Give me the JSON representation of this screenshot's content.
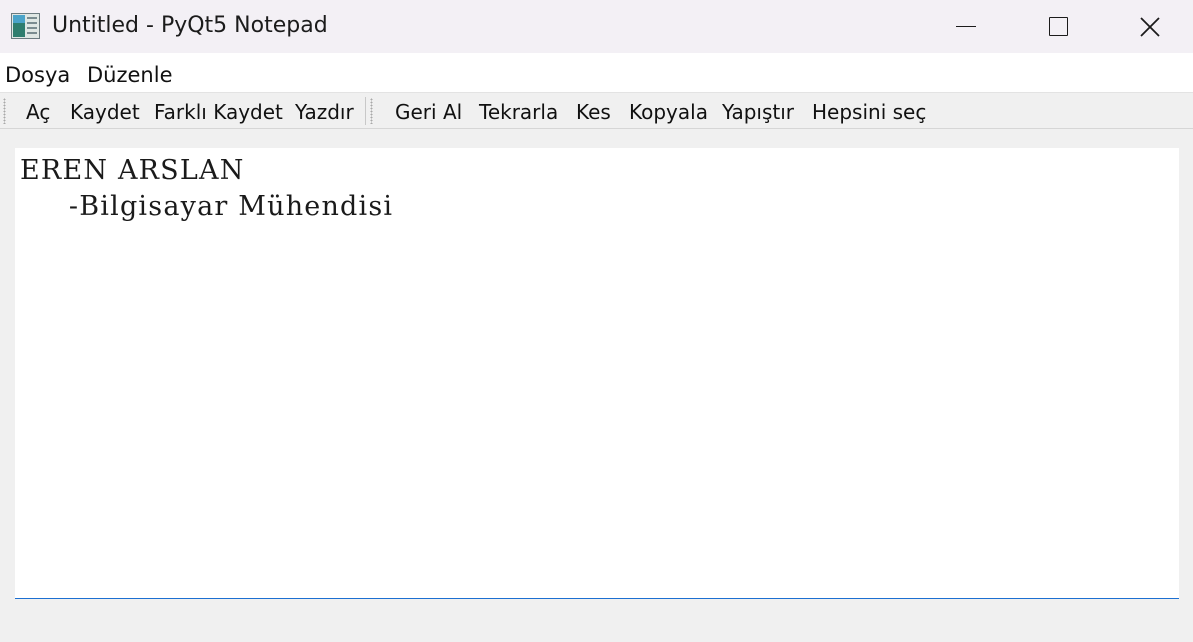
{
  "window": {
    "title": "Untitled - PyQt5 Notepad"
  },
  "menubar": {
    "items": [
      {
        "label": "Dosya"
      },
      {
        "label": "Düzenle"
      }
    ]
  },
  "toolbar": {
    "file_actions": [
      {
        "label": "Aç"
      },
      {
        "label": "Kaydet"
      },
      {
        "label": "Farklı Kaydet"
      },
      {
        "label": "Yazdır"
      }
    ],
    "edit_actions": [
      {
        "label": "Geri Al"
      },
      {
        "label": "Tekrarla"
      },
      {
        "label": "Kes"
      },
      {
        "label": "Kopyala"
      },
      {
        "label": "Yapıştır"
      },
      {
        "label": "Hepsini seç"
      }
    ]
  },
  "editor": {
    "content": "EREN ARSLAN\n     -Bilgisayar Mühendisi"
  },
  "icons": {
    "app": "notepad-app-icon",
    "minimize": "minimize-icon",
    "maximize": "maximize-icon",
    "close": "close-icon"
  },
  "colors": {
    "titlebar_bg": "#f3f0f5",
    "editor_focus_border": "#1c6fd1"
  }
}
